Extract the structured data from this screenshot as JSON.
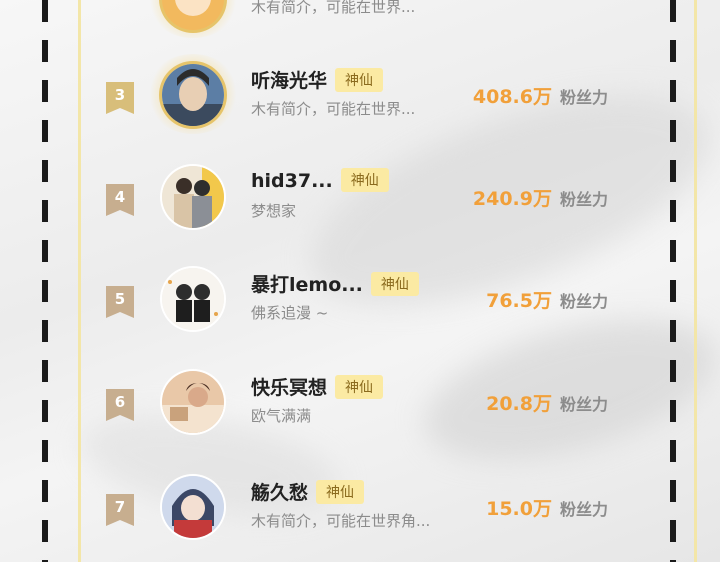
{
  "top_row": {
    "bio": "木有简介，可能在世界..."
  },
  "rows": [
    {
      "rank": "3",
      "name": "听海光华",
      "tag": "神仙",
      "bio": "木有简介，可能在世界...",
      "fans": "408.6万",
      "fans_label": "粉丝力"
    },
    {
      "rank": "4",
      "name": "hid37...",
      "tag": "神仙",
      "bio": "梦想家",
      "fans": "240.9万",
      "fans_label": "粉丝力"
    },
    {
      "rank": "5",
      "name": "暴打lemo...",
      "tag": "神仙",
      "bio": "佛系追漫 ~",
      "fans": "76.5万",
      "fans_label": "粉丝力"
    },
    {
      "rank": "6",
      "name": "快乐冥想",
      "tag": "神仙",
      "bio": "欧气满满",
      "fans": "20.8万",
      "fans_label": "粉丝力"
    },
    {
      "rank": "7",
      "name": "觞久愁",
      "tag": "神仙",
      "bio": "木有简介，可能在世界角...",
      "fans": "15.0万",
      "fans_label": "粉丝力"
    }
  ],
  "colors": {
    "accent": "#f1a03a",
    "tag_bg": "#fbeaa3",
    "rank_bg": "#c7ae8f",
    "gold": "#e6c46a"
  }
}
